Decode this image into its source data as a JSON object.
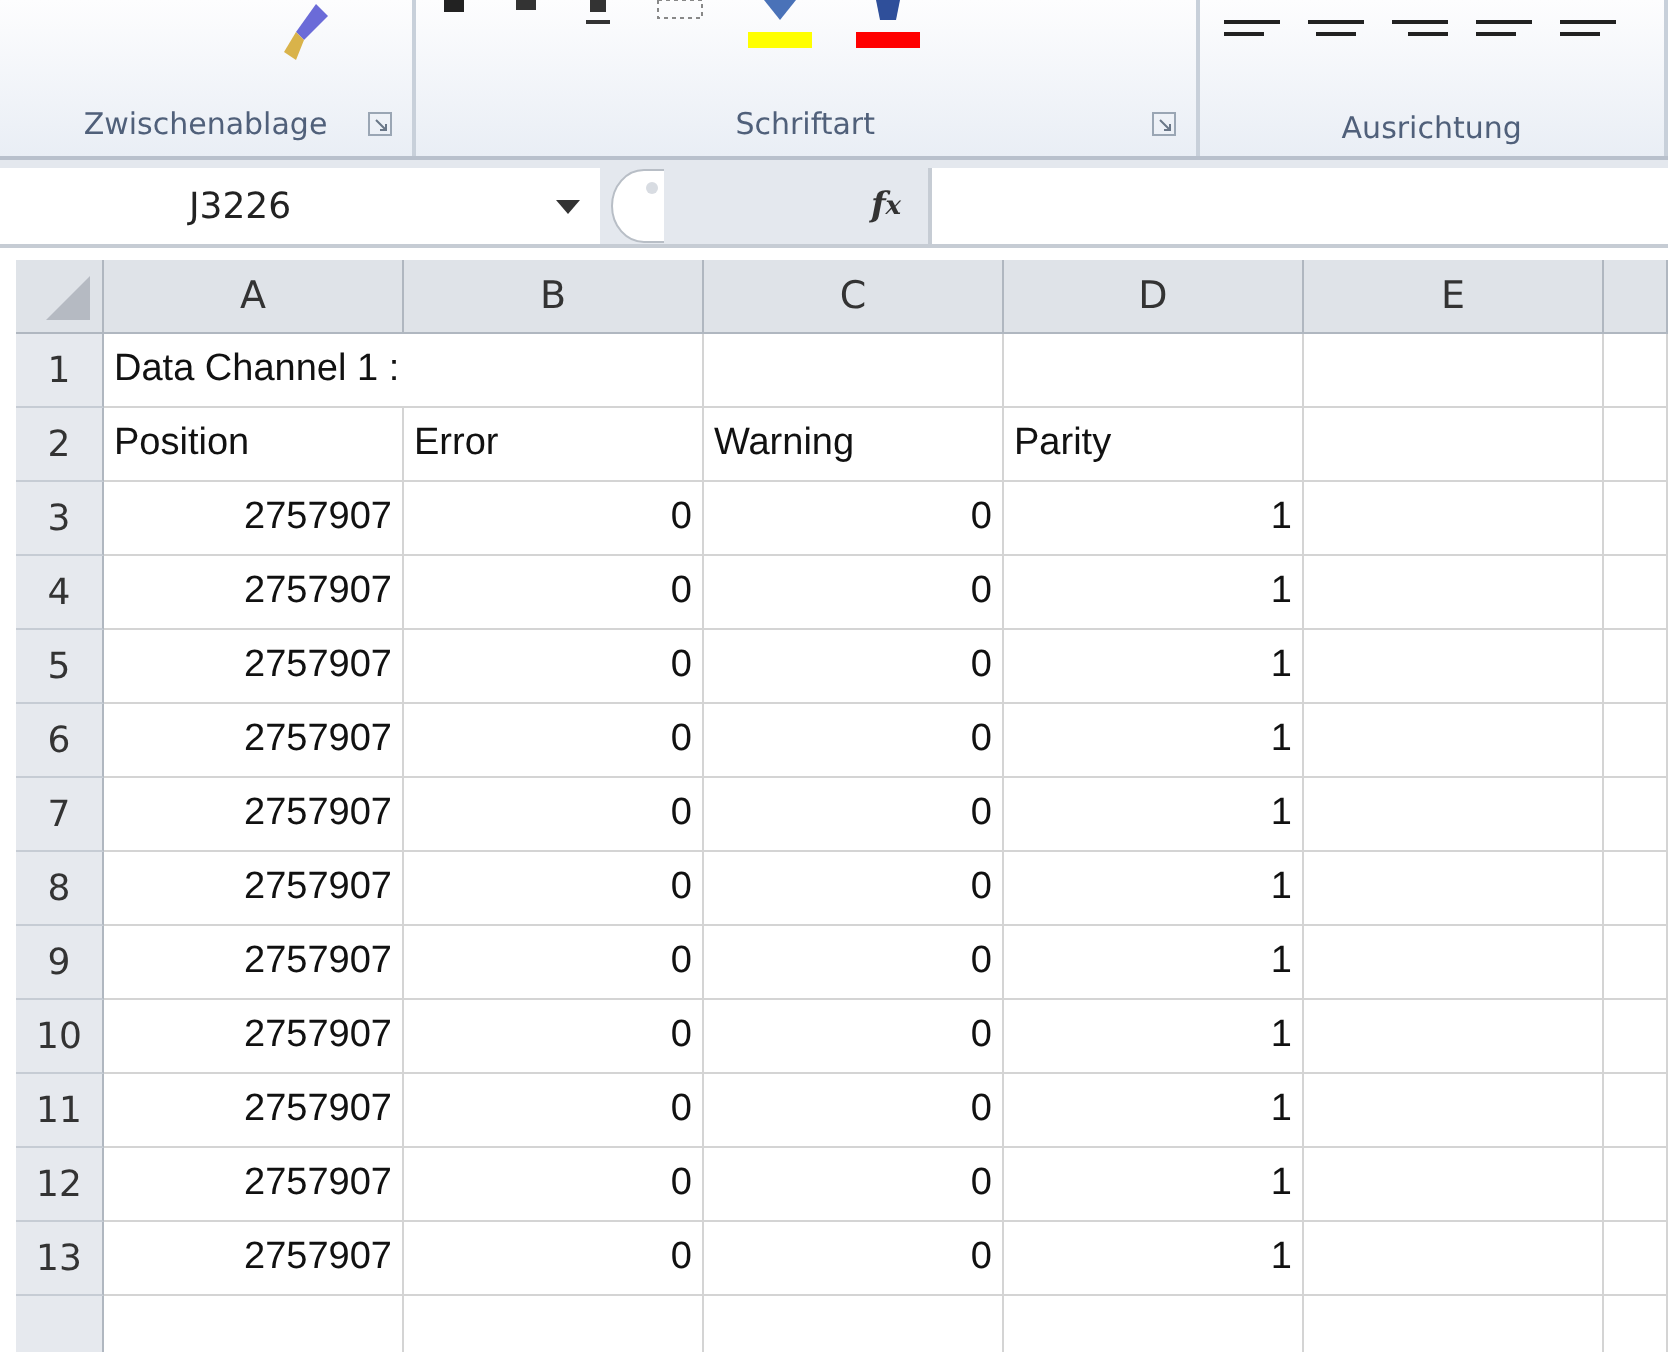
{
  "ribbon": {
    "groups": [
      {
        "label": "Zwischenablage",
        "launcher": true
      },
      {
        "label": "Schriftart",
        "launcher": true
      },
      {
        "label": "Ausrichtung"
      }
    ]
  },
  "formula_bar": {
    "name_box": "J3226",
    "fx": "fx"
  },
  "grid": {
    "columns": [
      "A",
      "B",
      "C",
      "D",
      "E"
    ],
    "rows": [
      {
        "header": "1",
        "kind": "text",
        "cells": [
          "Data Channel 1 :"
        ]
      },
      {
        "header": "2",
        "kind": "text",
        "cells": [
          "Position",
          "Error",
          "Warning",
          "Parity"
        ]
      },
      {
        "header": "3",
        "kind": "number",
        "cells": [
          "2757907",
          "0",
          "0",
          "1"
        ]
      },
      {
        "header": "4",
        "kind": "number",
        "cells": [
          "2757907",
          "0",
          "0",
          "1"
        ]
      },
      {
        "header": "5",
        "kind": "number",
        "cells": [
          "2757907",
          "0",
          "0",
          "1"
        ]
      },
      {
        "header": "6",
        "kind": "number",
        "cells": [
          "2757907",
          "0",
          "0",
          "1"
        ]
      },
      {
        "header": "7",
        "kind": "number",
        "cells": [
          "2757907",
          "0",
          "0",
          "1"
        ]
      },
      {
        "header": "8",
        "kind": "number",
        "cells": [
          "2757907",
          "0",
          "0",
          "1"
        ]
      },
      {
        "header": "9",
        "kind": "number",
        "cells": [
          "2757907",
          "0",
          "0",
          "1"
        ]
      },
      {
        "header": "10",
        "kind": "number",
        "cells": [
          "2757907",
          "0",
          "0",
          "1"
        ]
      },
      {
        "header": "11",
        "kind": "number",
        "cells": [
          "2757907",
          "0",
          "0",
          "1"
        ]
      },
      {
        "header": "12",
        "kind": "number",
        "cells": [
          "2757907",
          "0",
          "0",
          "1"
        ]
      },
      {
        "header": "13",
        "kind": "number",
        "cells": [
          "2757907",
          "0",
          "0",
          "1"
        ]
      }
    ]
  }
}
